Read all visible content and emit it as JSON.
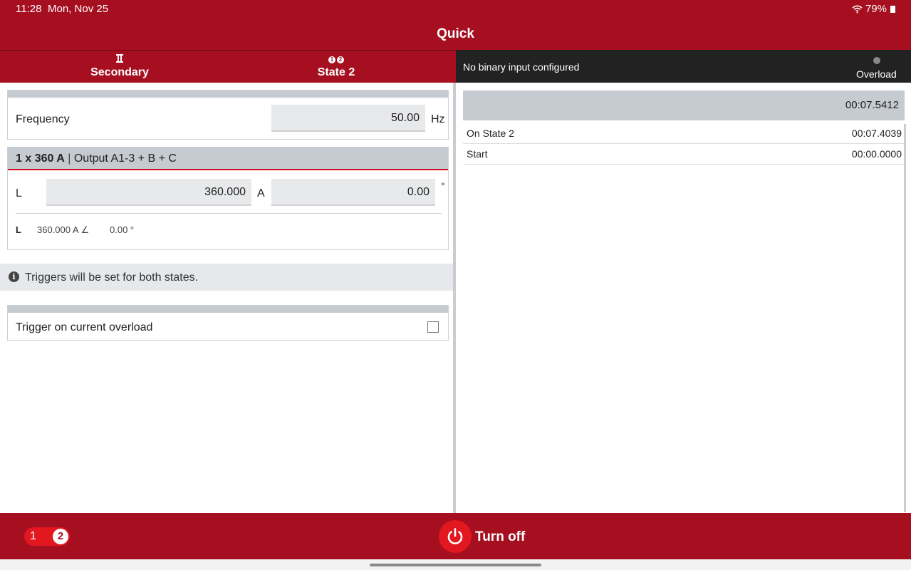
{
  "status_bar": {
    "time": "11:28",
    "date": "Mon, Nov 25",
    "battery": "79%"
  },
  "title": "Quick",
  "tabs": [
    {
      "label": "Secondary",
      "icon": "transformer-icon"
    },
    {
      "label": "State 2",
      "icon_digits": [
        "1",
        "2"
      ]
    }
  ],
  "binary_bar": {
    "text": "No binary input configured",
    "overload_label": "Overload"
  },
  "frequency": {
    "label": "Frequency",
    "value": "50.00",
    "unit": "Hz"
  },
  "output": {
    "header_bold": "1 x 360 A",
    "header_sep": " | ",
    "header_rest": "Output A1-3 + B + C",
    "phase_label": "L",
    "magnitude": "360.000",
    "magnitude_unit": "A",
    "angle": "0.00",
    "angle_unit": "°",
    "summary_label": "L",
    "summary_magnitude": "360.000 A ∠",
    "summary_angle": "0.00 °"
  },
  "info": {
    "text": "Triggers will be set for both states."
  },
  "trigger": {
    "label": "Trigger on current overload",
    "checked": false
  },
  "timer": {
    "total": "00:07.5412",
    "rows": [
      {
        "name": "On State 2",
        "value": "00:07.4039"
      },
      {
        "name": "Start",
        "value": "00:00.0000"
      }
    ]
  },
  "bottom": {
    "state_1": "1",
    "state_2": "2",
    "turn_off_label": "Turn off"
  },
  "colors": {
    "brand_red": "#a50f20",
    "accent_red": "#e2171f",
    "dark_bar": "#222222"
  }
}
